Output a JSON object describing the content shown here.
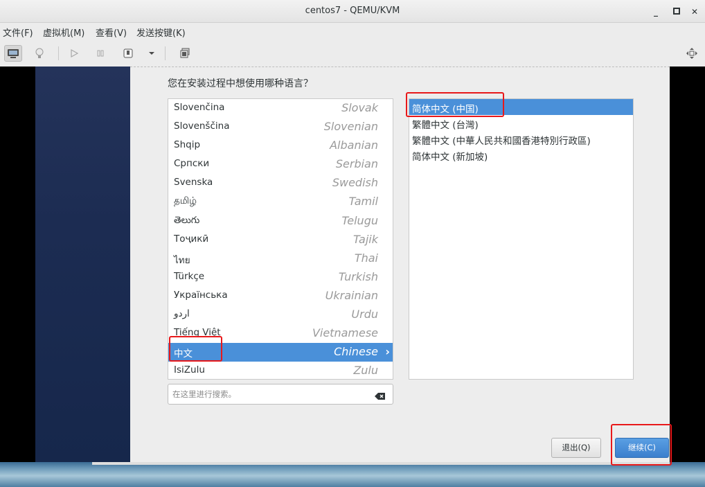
{
  "window": {
    "title": "centos7 - QEMU/KVM"
  },
  "menubar": {
    "items": [
      "文件(F)",
      "虚拟机(M)",
      "查看(V)",
      "发送按键(K)"
    ]
  },
  "installer": {
    "question": "您在安装过程中想使用哪种语言？",
    "languages": [
      {
        "native": "Slovenčina",
        "english": "Slovak"
      },
      {
        "native": "Slovenščina",
        "english": "Slovenian"
      },
      {
        "native": "Shqip",
        "english": "Albanian"
      },
      {
        "native": "Српски",
        "english": "Serbian"
      },
      {
        "native": "Svenska",
        "english": "Swedish"
      },
      {
        "native": "தமிழ்",
        "english": "Tamil"
      },
      {
        "native": "తెలుగు",
        "english": "Telugu"
      },
      {
        "native": "Тоҷикӣ",
        "english": "Tajik"
      },
      {
        "native": "ไทย",
        "english": "Thai"
      },
      {
        "native": "Türkçe",
        "english": "Turkish"
      },
      {
        "native": "Українська",
        "english": "Ukrainian"
      },
      {
        "native": "اردو",
        "english": "Urdu"
      },
      {
        "native": "Tiếng Việt",
        "english": "Vietnamese"
      },
      {
        "native": "中文",
        "english": "Chinese",
        "selected": true
      },
      {
        "native": "IsiZulu",
        "english": "Zulu"
      }
    ],
    "locales": [
      {
        "label": "简体中文 (中国)",
        "selected": true
      },
      {
        "label": "繁體中文 (台灣)"
      },
      {
        "label": "繁體中文 (中華人民共和國香港特別行政區)"
      },
      {
        "label": "简体中文 (新加坡)"
      }
    ],
    "search_placeholder": "在这里进行搜索。",
    "quit_label": "退出(Q)",
    "continue_label": "继续(C)"
  },
  "colors": {
    "selection": "#4a90d9",
    "annotation": "#e8181a",
    "continue_button": "#4a8ad8"
  }
}
